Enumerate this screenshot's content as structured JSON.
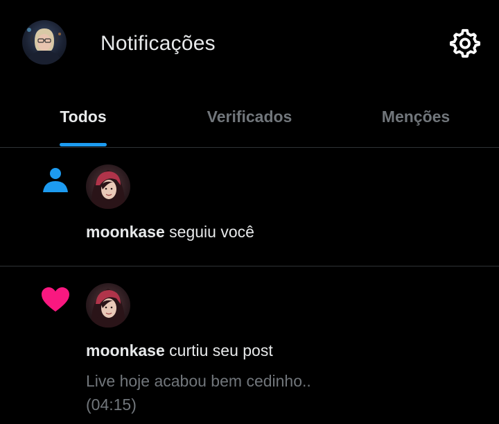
{
  "header": {
    "title": "Notificações",
    "avatar_icon": "user-avatar",
    "settings_icon": "gear-icon"
  },
  "tabs": [
    {
      "label": "Todos",
      "active": true
    },
    {
      "label": "Verificados",
      "active": false
    },
    {
      "label": "Menções",
      "active": false
    }
  ],
  "notifications": [
    {
      "type": "follow",
      "icon": "person-icon",
      "icon_color": "#1d9bf0",
      "user": "moonkase",
      "action": "seguiu você"
    },
    {
      "type": "like",
      "icon": "heart-icon",
      "icon_color": "#f91880",
      "user": "moonkase",
      "action": "curtiu seu post",
      "preview_line1": "Live hoje acabou bem cedinho..",
      "preview_line2": "(04:15)"
    }
  ],
  "colors": {
    "background": "#000000",
    "text_primary": "#e7e9ea",
    "text_secondary": "#71767b",
    "accent": "#1d9bf0",
    "divider": "#2f3336"
  }
}
